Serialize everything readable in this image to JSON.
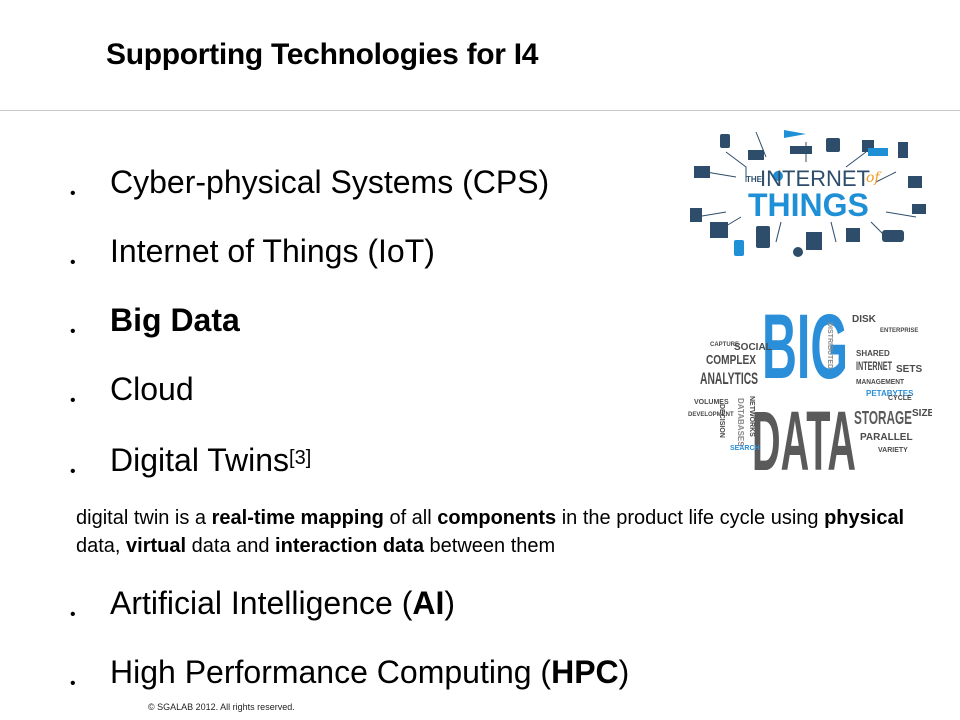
{
  "slide": {
    "title": "Supporting Technologies for I4",
    "bullet_marker": "•",
    "items": [
      {
        "parts": [
          "Cyber-physical Systems (CPS)"
        ]
      },
      {
        "parts": [
          "Internet of Things (IoT)"
        ]
      },
      {
        "parts": [
          "Big Data"
        ]
      },
      {
        "parts": [
          "Cloud"
        ]
      },
      {
        "text": "Digital Twins",
        "sup": "[3]"
      },
      {
        "pre": "Artificial Intelligence (",
        "bold": "AI",
        "post": ")"
      },
      {
        "pre": "High Performance Computing (",
        "bold": "HPC",
        "post": ")"
      }
    ],
    "definition": {
      "s1": "digital twin is a ",
      "b1": "real-time mapping",
      "s2": " of all ",
      "b2": "components",
      "s3": " in the product life cycle using ",
      "b3": "physical",
      "s4": " data, ",
      "b4": "virtual",
      "s5": " data and ",
      "b5": "interaction data",
      "s6": " between them"
    },
    "footer": "© SGALAB 2012. All rights reserved.",
    "iot_image": {
      "line1": "THE",
      "line2": "INTERNET",
      "line3": "of",
      "line4": "THINGS",
      "colors": {
        "blue": "#1f8fd6",
        "dark": "#2d4d6b",
        "accent": "#f39a1f"
      }
    },
    "bigdata_image": {
      "big": "BIG",
      "data": "DATA",
      "words": [
        "ANALYTICS",
        "COMPLEX",
        "STORAGE",
        "INTERNET",
        "SOCIAL",
        "MANAGEMENT",
        "PARALLEL",
        "PETABYTES",
        "SIZE",
        "DATABASES",
        "SEARCH",
        "DISK",
        "SETS",
        "SHARED",
        "CYCLE",
        "VOLUMES",
        "DEVELOPMENT",
        "NETWORKS",
        "DECISION",
        "CAPTURE",
        "ENTERPRISE",
        "DISTRIBUTED",
        "VARIETY"
      ],
      "colors": {
        "blue": "#2a8fd8",
        "gray": "#4a4a4a",
        "light": "#8a8a8a"
      }
    }
  }
}
